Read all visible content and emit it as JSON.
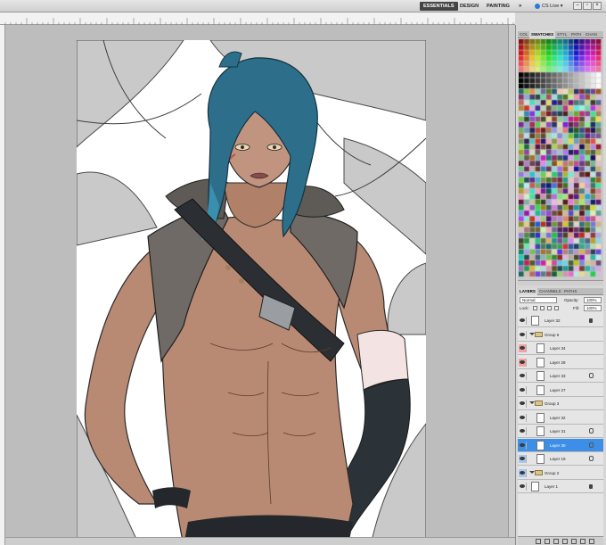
{
  "workspace": {
    "essentials": "ESSENTIALS",
    "design": "DESIGN",
    "painting": "PAINTING",
    "more": "»",
    "cs_live": "CS Live ▾"
  },
  "window_buttons": {
    "minimize": "–",
    "restore": "▫",
    "close": "×"
  },
  "swatches_panel": {
    "tabs": [
      "COL",
      "SWATCHES",
      "STYL",
      "PATH",
      "CHAN"
    ],
    "active_tab": "SWATCHES"
  },
  "layers_panel": {
    "tabs": [
      "LAYERS",
      "CHANNELS",
      "PATHS"
    ],
    "blend_mode": "Normal",
    "opacity_label": "Opacity:",
    "opacity": "100%",
    "lock_label": "Lock:",
    "fill_label": "Fill:",
    "fill": "100%",
    "layers": [
      {
        "name": "Layer 32",
        "kind": "layer",
        "eye": "on",
        "indent": 0,
        "icon": "lock",
        "selected": false
      },
      {
        "name": "Group 6",
        "kind": "group",
        "eye": "on",
        "indent": 0,
        "icon": "",
        "selected": false
      },
      {
        "name": "Layer 34",
        "kind": "layer",
        "eye": "red",
        "indent": 1,
        "icon": "",
        "selected": false
      },
      {
        "name": "Layer 28",
        "kind": "layer",
        "eye": "red",
        "indent": 1,
        "icon": "",
        "selected": false
      },
      {
        "name": "Layer 33",
        "kind": "layer",
        "eye": "on",
        "indent": 1,
        "icon": "link",
        "selected": false
      },
      {
        "name": "Layer 27",
        "kind": "layer",
        "eye": "on",
        "indent": 1,
        "icon": "",
        "selected": false
      },
      {
        "name": "Group 3",
        "kind": "group",
        "eye": "on",
        "indent": 0,
        "icon": "",
        "selected": false
      },
      {
        "name": "Layer 32",
        "kind": "layer",
        "eye": "on",
        "indent": 1,
        "icon": "",
        "selected": false
      },
      {
        "name": "Layer 31",
        "kind": "layer",
        "eye": "on",
        "indent": 1,
        "icon": "link",
        "selected": false
      },
      {
        "name": "Layer 30",
        "kind": "layer",
        "eye": "on",
        "indent": 1,
        "icon": "link",
        "selected": true
      },
      {
        "name": "Layer 19",
        "kind": "layer",
        "eye": "blue",
        "indent": 1,
        "icon": "link",
        "selected": false
      },
      {
        "name": "Group 2",
        "kind": "group",
        "eye": "blue",
        "indent": 0,
        "icon": "",
        "selected": false
      },
      {
        "name": "Layer 1",
        "kind": "layer",
        "eye": "on",
        "indent": 0,
        "icon": "lock",
        "selected": false
      }
    ]
  },
  "colors": {
    "selection": "#3d8ee6",
    "skin": "#b98a73",
    "hair": "#2d6f8a",
    "vest": "#6f6a66",
    "strap": "#2b2f33"
  }
}
